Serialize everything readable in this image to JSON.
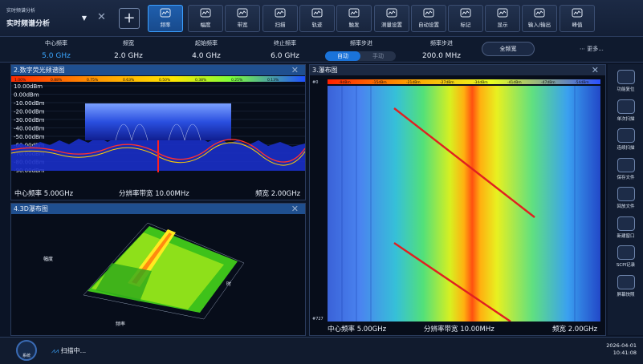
{
  "mode": {
    "small": "实时频谱分析",
    "title": "实时频谱分析"
  },
  "toolbar": [
    {
      "label": "频率",
      "icon": "wave-icon"
    },
    {
      "label": "幅度",
      "icon": "bars-icon"
    },
    {
      "label": "带宽",
      "icon": "bandwidth-icon"
    },
    {
      "label": "扫描",
      "icon": "clock-icon"
    },
    {
      "label": "轨迹",
      "icon": "trace-icon"
    },
    {
      "label": "触发",
      "icon": "trigger-icon"
    },
    {
      "label": "测量设置",
      "icon": "ruler-icon"
    },
    {
      "label": "自动设置",
      "icon": "auto-icon"
    },
    {
      "label": "标记",
      "icon": "flag-icon"
    },
    {
      "label": "显示",
      "icon": "eye-icon"
    },
    {
      "label": "输入/输出",
      "icon": "io-icon"
    },
    {
      "label": "峰值",
      "icon": "peak-icon"
    }
  ],
  "params": {
    "center": {
      "label": "中心频率",
      "value": "5.0 GHz"
    },
    "span": {
      "label": "频宽",
      "value": "2.0 GHz"
    },
    "start": {
      "label": "起始频率",
      "value": "4.0 GHz"
    },
    "stop": {
      "label": "终止频率",
      "value": "6.0 GHz"
    },
    "freq_step": {
      "label": "频率步进",
      "auto": "自动",
      "manual": "手动"
    },
    "amp_step": {
      "label": "频率步进",
      "value": "200.0 MHz"
    },
    "full_span": "全频宽",
    "more": "更多..."
  },
  "panel_spectrum": {
    "title": "2.数字荧光频谱图",
    "color_scale": [
      "1.00%",
      "0.88%",
      "0.75%",
      "0.63%",
      "0.50%",
      "0.38%",
      "0.25%",
      "0.13%"
    ],
    "y_ticks": [
      "10.00dBm",
      "0.00dBm",
      "-10.00dBm",
      "-20.00dBm",
      "-30.00dBm",
      "-40.00dBm",
      "-50.00dBm",
      "-60.00dBm",
      "-70.00dBm",
      "-80.00dBm",
      "-90.00dBm"
    ],
    "footer": {
      "center": "中心频率 5.00GHz",
      "rbw": "分辨率带宽 10.00MHz",
      "span": "频宽 2.00GHz"
    }
  },
  "panel_3d": {
    "title": "4.3D瀑布图",
    "axis_amp": "幅度",
    "axis_freq": "频率",
    "axis_time": "时"
  },
  "panel_waterfall": {
    "title": "3.瀑布图",
    "scale": [
      "-9dBm",
      "-15dBm",
      "-21dBm",
      "-27dBm",
      "-34dBm",
      "-41dBm",
      "-47dBm",
      "-54dBm"
    ],
    "row_top": "#0",
    "row_bottom": "#727",
    "footer": {
      "center": "中心频率 5.00GHz",
      "rbw": "分辨率带宽 10.00MHz",
      "span": "频宽 2.00GHz"
    }
  },
  "rightbar": [
    "功能复位",
    "单次扫描",
    "连续扫描",
    "保存文件",
    "回放文件",
    "新建窗口",
    "SCPI记录",
    "屏幕快照"
  ],
  "status": {
    "system": "系统",
    "scan": "扫描中...",
    "date": "2026-04-01",
    "time": "10:41:08"
  }
}
